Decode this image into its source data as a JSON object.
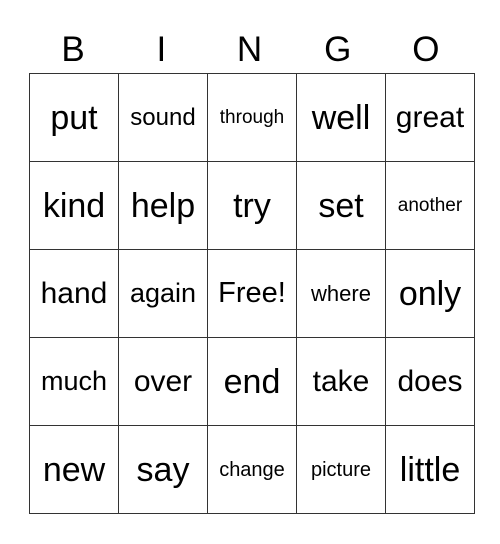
{
  "header": [
    "B",
    "I",
    "N",
    "G",
    "O"
  ],
  "rows": [
    [
      "put",
      "sound",
      "through",
      "well",
      "great"
    ],
    [
      "kind",
      "help",
      "try",
      "set",
      "another"
    ],
    [
      "hand",
      "again",
      "Free!",
      "where",
      "only"
    ],
    [
      "much",
      "over",
      "end",
      "take",
      "does"
    ],
    [
      "new",
      "say",
      "change",
      "picture",
      "little"
    ]
  ]
}
